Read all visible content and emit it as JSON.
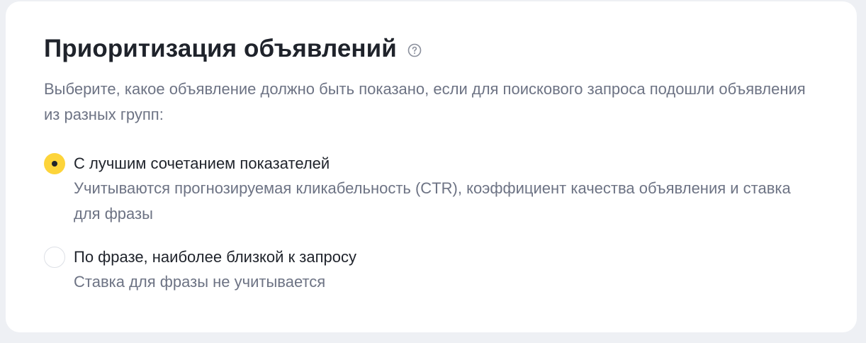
{
  "section": {
    "title": "Приоритизация объявлений",
    "help_icon": "question-circle-icon",
    "description": "Выберите, какое объявление должно быть показано, если для поискового запроса подошли объявления из разных групп:"
  },
  "options": [
    {
      "label": "С лучшим сочетанием показателей",
      "description": "Учитываются прогнозируемая кликабельность (CTR), коэффициент качества объявления и ставка для фразы",
      "selected": true
    },
    {
      "label": "По фразе, наиболее близкой к запросу",
      "description": "Ставка для фразы не учитывается",
      "selected": false
    }
  ],
  "colors": {
    "accent": "#fdd43a",
    "text_primary": "#1f232b",
    "text_secondary": "#6d7384",
    "page_background": "#eef0f4",
    "card_background": "#ffffff"
  }
}
